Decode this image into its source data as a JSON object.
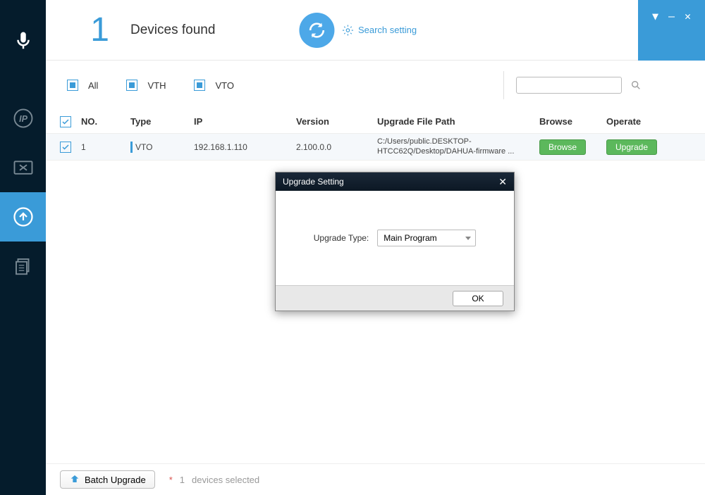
{
  "header": {
    "count": "1",
    "title": "Devices found",
    "search_setting": "Search setting"
  },
  "filters": {
    "all": "All",
    "vth": "VTH",
    "vto": "VTO"
  },
  "search": {
    "placeholder": ""
  },
  "table": {
    "headers": {
      "no": "NO.",
      "type": "Type",
      "ip": "IP",
      "version": "Version",
      "path": "Upgrade File Path",
      "browse": "Browse",
      "operate": "Operate"
    },
    "rows": [
      {
        "no": "1",
        "type": "VTO",
        "ip": "192.168.1.110",
        "version": "2.100.0.0",
        "path": "C:/Users/public.DESKTOP-HTCC62Q/Desktop/DAHUA-firmware ...",
        "browse_label": "Browse",
        "operate_label": "Upgrade"
      }
    ]
  },
  "footer": {
    "batch": "Batch Upgrade",
    "asterisk": "*",
    "count": "1",
    "label": "devices selected"
  },
  "modal": {
    "title": "Upgrade Setting",
    "label": "Upgrade Type:",
    "selected": "Main Program",
    "ok": "OK"
  }
}
